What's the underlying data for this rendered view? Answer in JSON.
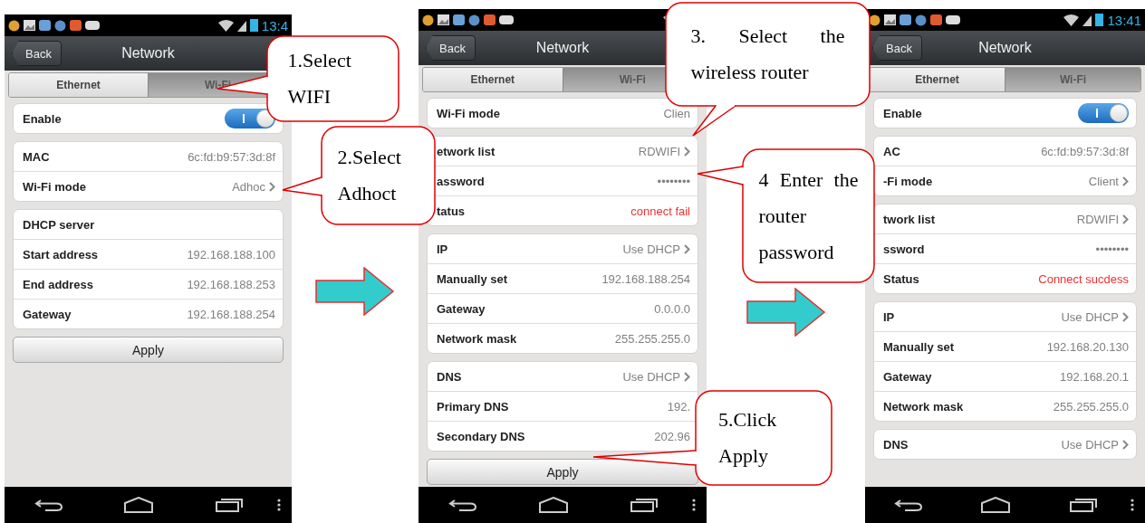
{
  "screens": [
    {
      "status_time": "13:4",
      "back": "Back",
      "title": "Network",
      "tabs": [
        {
          "label": "Ethernet",
          "selected": false
        },
        {
          "label": "Wi-Fi",
          "selected": true
        }
      ],
      "groups": [
        {
          "rows": [
            {
              "kind": "switch",
              "label": "Enable",
              "on": true
            }
          ]
        },
        {
          "rows": [
            {
              "kind": "info",
              "label": "MAC",
              "value": "6c:fd:b9:57:3d:8f"
            },
            {
              "kind": "link",
              "label": "Wi-Fi mode",
              "value": "Adhoc"
            }
          ]
        },
        {
          "rows": [
            {
              "kind": "header",
              "label": "DHCP server"
            },
            {
              "kind": "info",
              "label": "Start address",
              "value": "192.168.188.100"
            },
            {
              "kind": "info",
              "label": "End address",
              "value": "192.168.188.253"
            },
            {
              "kind": "info",
              "label": "Gateway",
              "value": "192.168.188.254"
            }
          ]
        }
      ],
      "apply": "Apply"
    },
    {
      "back": "Back",
      "title": "Network",
      "tabs": [
        {
          "label": "Ethernet",
          "selected": false
        },
        {
          "label": "Wi-Fi",
          "selected": true
        }
      ],
      "groups": [
        {
          "rows": [
            {
              "kind": "info",
              "label": "Wi-Fi mode",
              "value": "Clien"
            }
          ]
        },
        {
          "rows": [
            {
              "kind": "link",
              "label": "etwork list",
              "value": "RDWIFI"
            },
            {
              "kind": "info",
              "label": "assword",
              "value": "••••••••"
            },
            {
              "kind": "status",
              "label": "tatus",
              "value": "connect fail"
            }
          ]
        },
        {
          "rows": [
            {
              "kind": "link",
              "label": "IP",
              "value": "Use DHCP"
            },
            {
              "kind": "info",
              "label": "Manually set",
              "value": "192.168.188.254"
            },
            {
              "kind": "info",
              "label": "Gateway",
              "value": "0.0.0.0"
            },
            {
              "kind": "info",
              "label": "Network mask",
              "value": "255.255.255.0"
            }
          ]
        },
        {
          "rows": [
            {
              "kind": "link",
              "label": "DNS",
              "value": "Use DHCP"
            },
            {
              "kind": "info",
              "label": "Primary DNS",
              "value": "192."
            },
            {
              "kind": "info",
              "label": "Secondary DNS",
              "value": "202.96"
            }
          ]
        }
      ],
      "apply": "Apply"
    },
    {
      "status_time": "13:41",
      "back": "Back",
      "title": "Network",
      "tabs": [
        {
          "label": "Ethernet",
          "selected": false
        },
        {
          "label": "Wi-Fi",
          "selected": true
        }
      ],
      "groups": [
        {
          "rows": [
            {
              "kind": "switch",
              "label": "Enable",
              "on": true
            }
          ]
        },
        {
          "rows": [
            {
              "kind": "info",
              "label": "AC",
              "value": "6c:fd:b9:57:3d:8f"
            },
            {
              "kind": "link",
              "label": "-Fi mode",
              "value": "Client"
            }
          ]
        },
        {
          "rows": [
            {
              "kind": "link",
              "label": "twork list",
              "value": "RDWIFI"
            },
            {
              "kind": "info",
              "label": "ssword",
              "value": "••••••••"
            },
            {
              "kind": "status",
              "label": "Status",
              "value": "Connect sucdess"
            }
          ]
        },
        {
          "rows": [
            {
              "kind": "link",
              "label": "IP",
              "value": "Use DHCP"
            },
            {
              "kind": "info",
              "label": "Manually set",
              "value": "192.168.20.130"
            },
            {
              "kind": "info",
              "label": "Gateway",
              "value": "192.168.20.1"
            },
            {
              "kind": "info",
              "label": "Network mask",
              "value": "255.255.255.0"
            }
          ]
        },
        {
          "rows": [
            {
              "kind": "link",
              "label": "DNS",
              "value": "Use DHCP"
            }
          ]
        }
      ]
    }
  ],
  "callouts": [
    {
      "text": "1.Select WIFI"
    },
    {
      "text": "2.Select Adhoct"
    },
    {
      "text": "3. Select the wireless router"
    },
    {
      "text": "4 Enter the router password"
    },
    {
      "text": "5.Click Apply"
    }
  ]
}
